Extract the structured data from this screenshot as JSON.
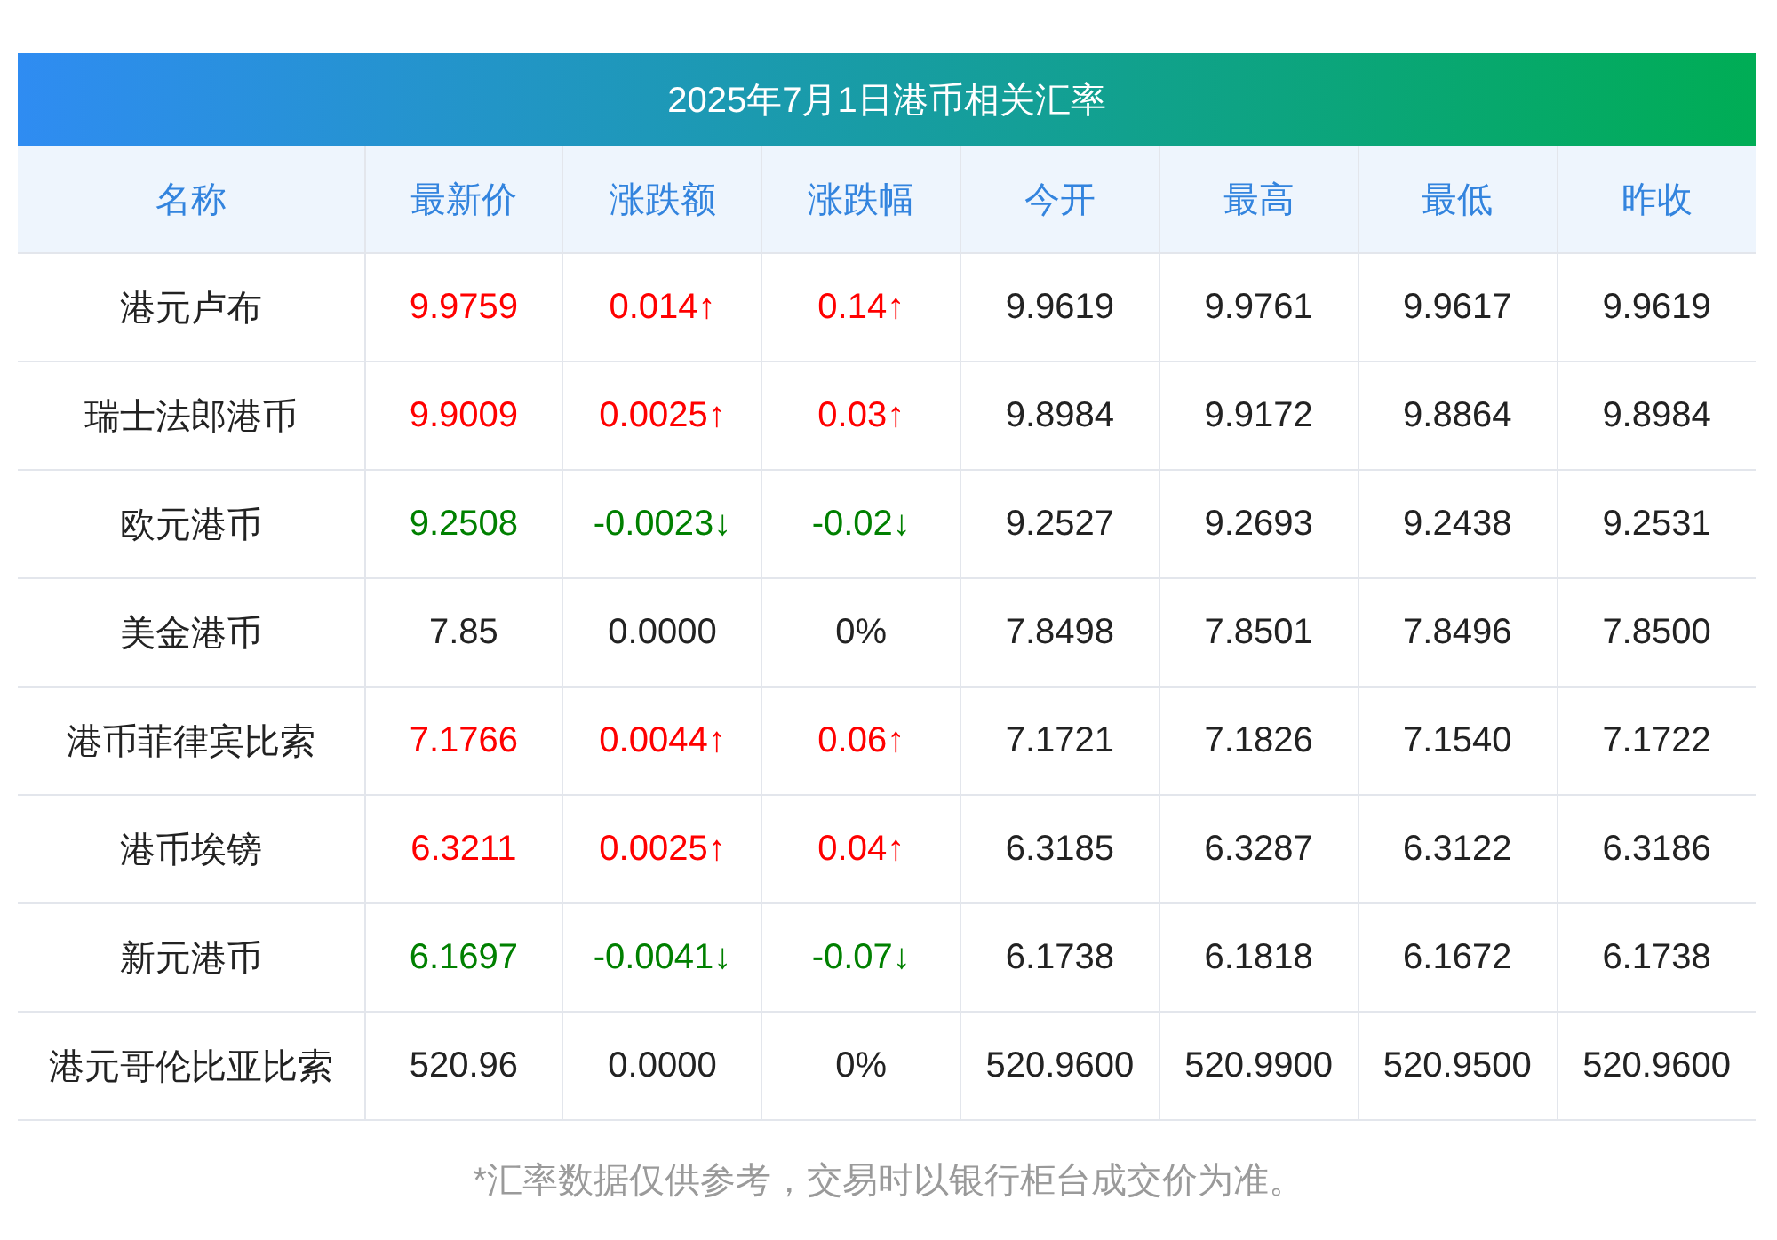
{
  "title": "2025年7月1日港币相关汇率",
  "columns": [
    "名称",
    "最新价",
    "涨跌额",
    "涨跌幅",
    "今开",
    "最高",
    "最低",
    "昨收"
  ],
  "rows": [
    {
      "name": "港元卢布",
      "color": "#ff0000",
      "price": "9.9759",
      "change": "0.014↑",
      "pct": "0.14↑",
      "open": "9.9619",
      "high": "9.9761",
      "low": "9.9617",
      "prev": "9.9619"
    },
    {
      "name": "瑞士法郎港币",
      "color": "#ff0000",
      "price": "9.9009",
      "change": "0.0025↑",
      "pct": "0.03↑",
      "open": "9.8984",
      "high": "9.9172",
      "low": "9.8864",
      "prev": "9.8984"
    },
    {
      "name": "欧元港币",
      "color": "#008000",
      "price": "9.2508",
      "change": "-0.0023↓",
      "pct": "-0.02↓",
      "open": "9.2527",
      "high": "9.2693",
      "low": "9.2438",
      "prev": "9.2531"
    },
    {
      "name": "美金港币",
      "color": "#222222",
      "price": "7.85",
      "change": "0.0000",
      "pct": "0%",
      "open": "7.8498",
      "high": "7.8501",
      "low": "7.8496",
      "prev": "7.8500"
    },
    {
      "name": "港币菲律宾比索",
      "color": "#ff0000",
      "price": "7.1766",
      "change": "0.0044↑",
      "pct": "0.06↑",
      "open": "7.1721",
      "high": "7.1826",
      "low": "7.1540",
      "prev": "7.1722"
    },
    {
      "name": "港币埃镑",
      "color": "#ff0000",
      "price": "6.3211",
      "change": "0.0025↑",
      "pct": "0.04↑",
      "open": "6.3185",
      "high": "6.3287",
      "low": "6.3122",
      "prev": "6.3186"
    },
    {
      "name": "新元港币",
      "color": "#008000",
      "price": "6.1697",
      "change": "-0.0041↓",
      "pct": "-0.07↓",
      "open": "6.1738",
      "high": "6.1818",
      "low": "6.1672",
      "prev": "6.1738"
    },
    {
      "name": "港元哥伦比亚比索",
      "color": "#222222",
      "price": "520.96",
      "change": "0.0000",
      "pct": "0%",
      "open": "520.9600",
      "high": "520.9900",
      "low": "520.9500",
      "prev": "520.9600"
    }
  ],
  "note": "*汇率数据仅供参考，交易时以银行柜台成交价为准。"
}
